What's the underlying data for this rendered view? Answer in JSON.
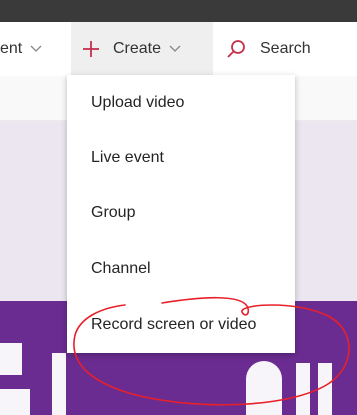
{
  "navbar": {
    "truncated_item": "ent",
    "create_label": "Create",
    "search_label": "Search"
  },
  "create_menu": {
    "items": [
      {
        "label": "Upload video"
      },
      {
        "label": "Live event"
      },
      {
        "label": "Group"
      },
      {
        "label": "Channel"
      },
      {
        "label": "Record screen or video"
      }
    ]
  },
  "colors": {
    "accent": "#c4314b",
    "brand_purple": "#6a2c91",
    "annotation": "#e8202a"
  }
}
